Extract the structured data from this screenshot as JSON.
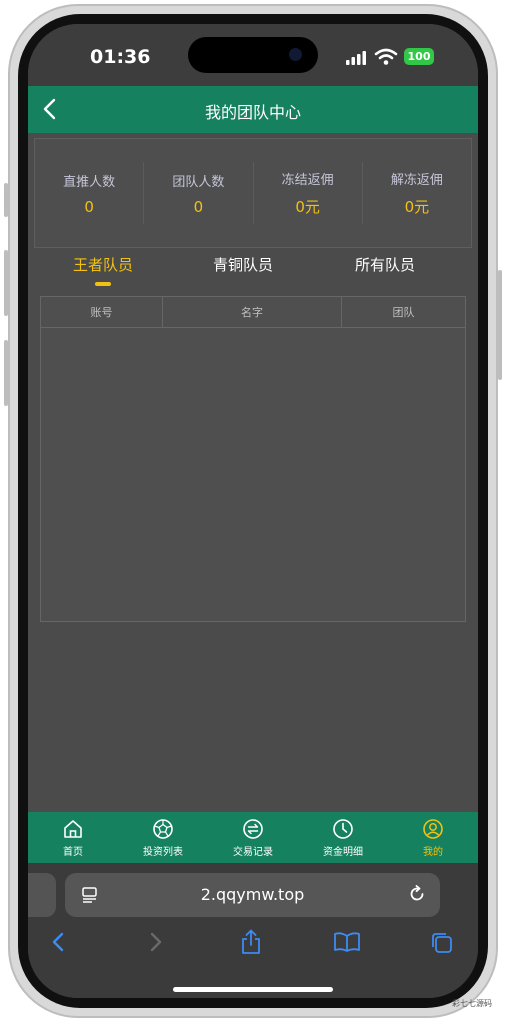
{
  "status_bar": {
    "time": "01:36",
    "battery": "100"
  },
  "header": {
    "title": "我的团队中心"
  },
  "stats": [
    {
      "label": "直推人数",
      "value": "0"
    },
    {
      "label": "团队人数",
      "value": "0"
    },
    {
      "label": "冻结返佣",
      "value": "0元"
    },
    {
      "label": "解冻返佣",
      "value": "0元"
    }
  ],
  "tabs": [
    {
      "label": "王者队员",
      "active": true
    },
    {
      "label": "青铜队员",
      "active": false
    },
    {
      "label": "所有队员",
      "active": false
    }
  ],
  "table": {
    "columns": [
      "账号",
      "名字",
      "团队"
    ],
    "rows": []
  },
  "tabbar": [
    {
      "label": "首页",
      "icon": "home-icon",
      "active": false
    },
    {
      "label": "投资列表",
      "icon": "ball-icon",
      "active": false
    },
    {
      "label": "交易记录",
      "icon": "exchange-icon",
      "active": false
    },
    {
      "label": "资金明细",
      "icon": "clock-icon",
      "active": false
    },
    {
      "label": "我的",
      "icon": "user-icon",
      "active": true
    }
  ],
  "browser": {
    "url": "2.qqymw.top"
  },
  "watermark": "彩七七源码",
  "colors": {
    "accent": "#15815e",
    "highlight": "#f2c111",
    "background": "#4b4b4b"
  }
}
